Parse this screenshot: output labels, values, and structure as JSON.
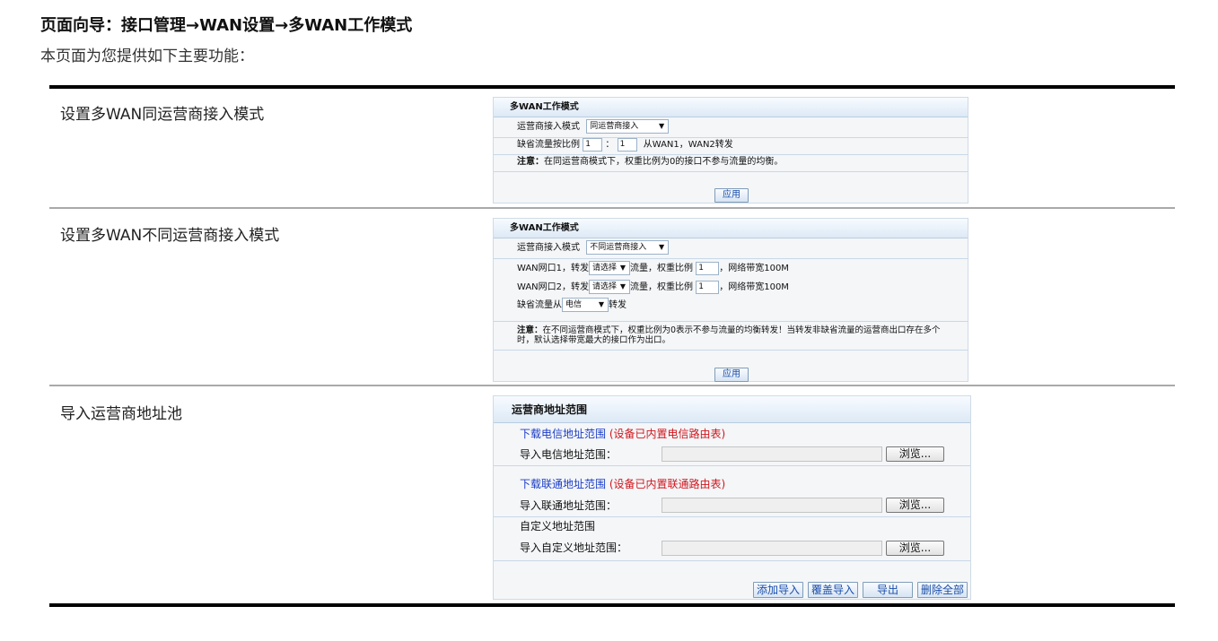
{
  "page": {
    "title": "页面向导：接口管理→WAN设置→多WAN工作模式",
    "intro": "本页面为您提供如下主要功能："
  },
  "rows": [
    {
      "label": "设置多WAN同运营商接入模式"
    },
    {
      "label": "设置多WAN不同运营商接入模式"
    },
    {
      "label": "导入运营商地址池"
    }
  ],
  "panel1": {
    "title": "多WAN工作模式",
    "mode_label": "运营商接入模式",
    "mode_value": "同运营商接入",
    "ratio_label": "缺省流量按比例",
    "ratio_a": "1",
    "ratio_colon": "：",
    "ratio_b": "1",
    "ratio_suffix": "从WAN1，WAN2转发",
    "note_bold": "注意：",
    "note_text": "在同运营商模式下，权重比例为0的接口不参与流量的均衡。",
    "apply": "应用"
  },
  "panel2": {
    "title": "多WAN工作模式",
    "mode_label": "运营商接入模式",
    "mode_value": "不同运营商接入",
    "wan1_prefix": "WAN网口1，转发",
    "wan1_select": "请选择",
    "wan1_mid": "流量，权重比例",
    "wan1_weight": "1",
    "wan1_suffix": "，网络带宽100M",
    "wan2_prefix": "WAN网口2，转发",
    "wan2_select": "请选择",
    "wan2_mid": "流量，权重比例",
    "wan2_weight": "1",
    "wan2_suffix": "，网络带宽100M",
    "default_prefix": "缺省流量从",
    "default_select": "电信",
    "default_suffix": "转发",
    "note_bold": "注意：",
    "note_line1": "在不同运营商模式下，权重比例为0表示不参与流量的均衡转发！当转发非缺省流量的运营商出口存在多个",
    "note_line2": "时，默认选择带宽最大的接口作为出口。",
    "apply": "应用"
  },
  "panel3": {
    "title": "运营商地址范围",
    "telecom_link": "下载电信地址范围",
    "telecom_note": "(设备已内置电信路由表)",
    "telecom_import": "导入电信地址范围：",
    "unicom_link": "下载联通地址范围",
    "unicom_note": "(设备已内置联通路由表)",
    "unicom_import": "导入联通地址范围：",
    "custom_title": "自定义地址范围",
    "custom_import": "导入自定义地址范围：",
    "browse": "浏览...",
    "add_import": "添加导入",
    "overwrite_import": "覆盖导入",
    "export": "导出",
    "delete_all": "删除全部"
  },
  "icons": {
    "dropdown": "chevron-down-icon"
  }
}
